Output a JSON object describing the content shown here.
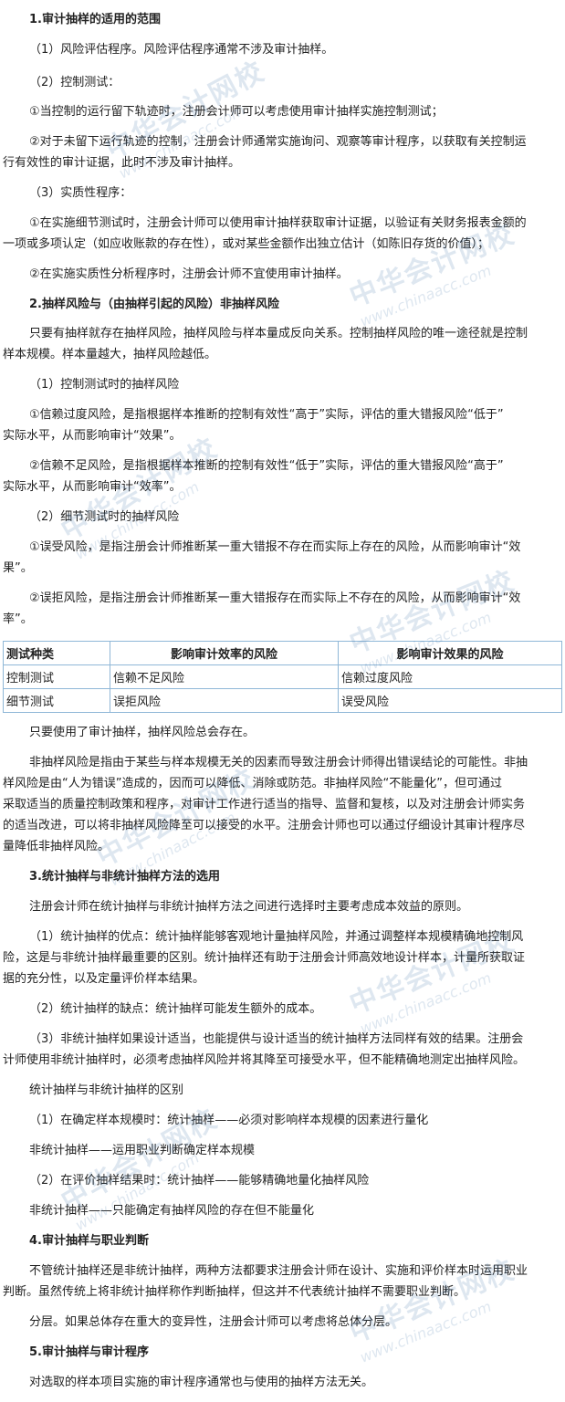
{
  "watermark": {
    "cn": "中华会计网校",
    "en": "www.chinaacc.com"
  },
  "sections": {
    "s1_title": "1.审计抽样的适用的范围",
    "s1_p1": "（1）风险评估程序。风险评估程序通常不涉及审计抽样。",
    "s1_p2": "（2）控制测试：",
    "s1_p3": "①当控制的运行留下轨迹时，注册会计师可以考虑使用审计抽样实施控制测试；",
    "s1_p4a": "②对于未留下运行轨迹的控制，注册会计师通常实施询问、观察等审计程序，以获取有关控制运",
    "s1_p4b": "行有效性的审计证据，此时不涉及审计抽样。",
    "s1_p5": "（3）实质性程序：",
    "s1_p6a": "①在实施细节测试时，注册会计师可以使用审计抽样获取审计证据，以验证有关财务报表金额的",
    "s1_p6b": "一项或多项认定（如应收账款的存在性），或对某些金额作出独立估计（如陈旧存货的价值）；",
    "s1_p7": "②在实施实质性分析程序时，注册会计师不宜使用审计抽样。",
    "s2_title": "2.抽样风险与（由抽样引起的风险）非抽样风险",
    "s2_p1a": "只要有抽样就存在抽样风险，抽样风险与样本量成反向关系。控制抽样风险的唯一途径就是控制",
    "s2_p1b": "样本规模。样本量越大，抽样风险越低。",
    "s2_p2": "（1）控制测试时的抽样风险",
    "s2_p3a": "①信赖过度风险，是指根据样本推断的控制有效性“高于”实际，评估的重大错报风险“低于”",
    "s2_p3b": "实际水平，从而影响审计“效果”。",
    "s2_p4a": "②信赖不足风险，是指根据样本推断的控制有效性“低于”实际，评估的重大错报风险“高于”",
    "s2_p4b": "实际水平，从而影响审计“效率”。",
    "s2_p5": "（2）细节测试时的抽样风险",
    "s2_p6a": "①误受风险，是指注册会计师推断某一重大错报不存在而实际上存在的风险，从而影响审计“效",
    "s2_p6b": "果”。",
    "s2_p7a": "②误拒风险，是指注册会计师推断某一重大错报存在而实际上不存在的风险，从而影响审计“效",
    "s2_p7b": "率”。",
    "after_p1": "只要使用了审计抽样，抽样风险总会存在。",
    "after_p2a": "非抽样风险是指由于某些与样本规模无关的因素而导致注册会计师得出错误结论的可能性。非抽",
    "after_p2b": "样风险是由“人为错误”造成的，因而可以降低、消除或防范。非抽样风险“不能量化”，但可通过",
    "after_p2c": "采取适当的质量控制政策和程序，对审计工作进行适当的指导、监督和复核，以及对注册会计师实务",
    "after_p2d": "的适当改进，可以将非抽样风险降至可以接受的水平。注册会计师也可以通过仔细设计其审计程序尽",
    "after_p2e": "量降低非抽样风险。",
    "s3_title": "3.统计抽样与非统计抽样方法的选用",
    "s3_p1": "注册会计师在统计抽样与非统计抽样方法之间进行选择时主要考虑成本效益的原则。",
    "s3_p2a": "（1）统计抽样的优点：统计抽样能够客观地计量抽样风险，并通过调整样本规模精确地控制风",
    "s3_p2b": "险，这是与非统计抽样最重要的区别。统计抽样还有助于注册会计师高效地设计样本，计量所获取证",
    "s3_p2c": "据的充分性，以及定量评价样本结果。",
    "s3_p3": "（2）统计抽样的缺点：统计抽样可能发生额外的成本。",
    "s3_p4a": "（3）非统计抽样如果设计适当，也能提供与设计适当的统计抽样方法同样有效的结果。注册会",
    "s3_p4b": "计师使用非统计抽样时，必须考虑抽样风险并将其降至可接受水平，但不能精确地测定出抽样风险。",
    "s3_p5": "统计抽样与非统计抽样的区别",
    "s3_p6": "（1）在确定样本规模时：统计抽样——必须对影响样本规模的因素进行量化",
    "s3_p7": "非统计抽样——运用职业判断确定样本规模",
    "s3_p8": "（2）在评价抽样结果时：统计抽样——能够精确地量化抽样风险",
    "s3_p9": "非统计抽样——只能确定有抽样风险的存在但不能量化",
    "s4_title": "4.审计抽样与职业判断",
    "s4_p1a": "不管统计抽样还是非统计抽样，两种方法都要求注册会计师在设计、实施和评价样本时运用职业",
    "s4_p1b": "判断。虽然传统上将非统计抽样称作判断抽样，但这并不代表统计抽样不需要职业判断。",
    "s4_p2": "分层。如果总体存在重大的变异性，注册会计师可以考虑将总体分层。",
    "s5_title": "5.审计抽样与审计程序",
    "s5_p1": "对选取的样本项目实施的审计程序通常也与使用的抽样方法无关。"
  },
  "table": {
    "headers": [
      "测试种类",
      "影响审计效率的风险",
      "影响审计效果的风险"
    ],
    "rows": [
      [
        "控制测试",
        "信赖不足风险",
        "信赖过度风险"
      ],
      [
        "细节测试",
        "误拒风险",
        "误受风险"
      ]
    ]
  }
}
